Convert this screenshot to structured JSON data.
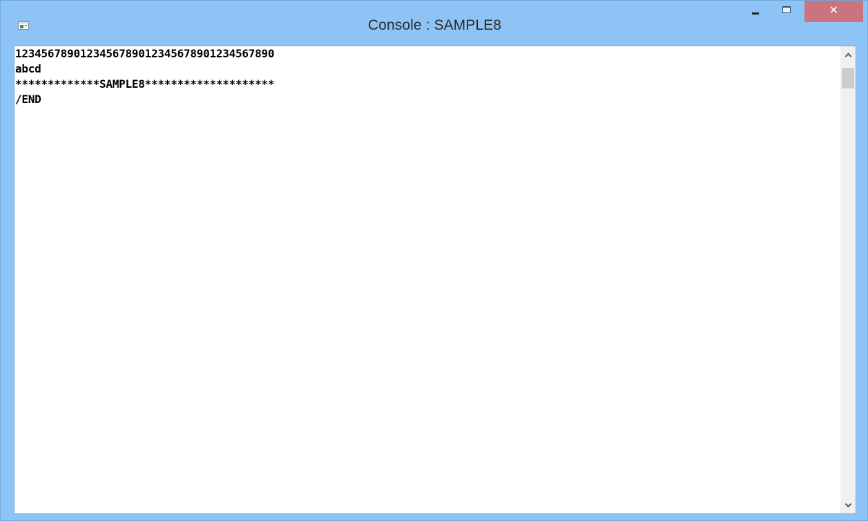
{
  "window": {
    "title": "Console : SAMPLE8",
    "app_icon": "console-window-icon",
    "controls": {
      "minimize_icon": "minimize-icon",
      "maximize_icon": "maximize-icon",
      "close_icon": "close-icon",
      "close_label": "✕"
    },
    "colors": {
      "frame": "#8ec4f5",
      "close_button": "#c9747f",
      "console_background": "#ffffff",
      "console_text": "#000000"
    }
  },
  "console": {
    "lines": [
      "1234567890123456789012345678901234567890",
      "abcd",
      "*************SAMPLE8********************",
      "/END"
    ]
  },
  "scrollbar": {
    "up_icon": "chevron-up-icon",
    "down_icon": "chevron-down-icon"
  }
}
